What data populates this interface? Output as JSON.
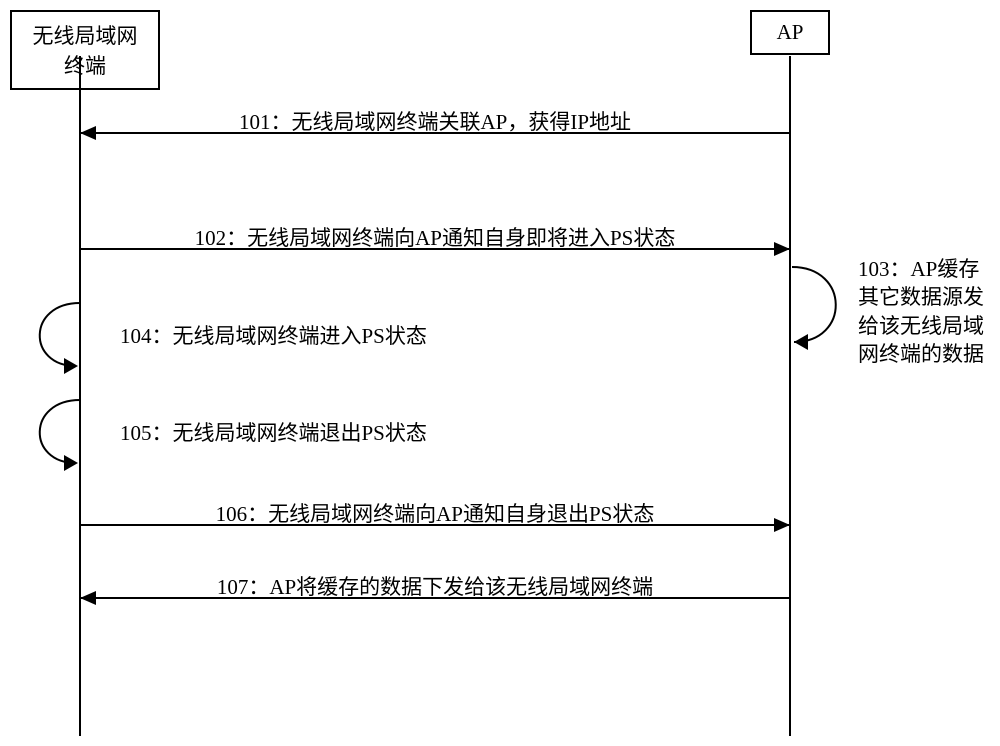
{
  "participants": {
    "left": "无线局域网终端",
    "right": "AP"
  },
  "messages": {
    "m101": "101：无线局域网终端关联AP，获得IP地址",
    "m102": "102：无线局域网终端向AP通知自身即将进入PS状态",
    "m103_l1": "103：AP缓存",
    "m103_l2": "其它数据源发",
    "m103_l3": "给该无线局域",
    "m103_l4": "网终端的数据",
    "m104": "104：无线局域网终端进入PS状态",
    "m105": "105：无线局域网终端退出PS状态",
    "m106": "106：无线局域网终端向AP通知自身退出PS状态",
    "m107": "107：AP将缓存的数据下发给该无线局域网终端"
  },
  "lifelines": {
    "leftX": 80,
    "rightX": 790
  }
}
